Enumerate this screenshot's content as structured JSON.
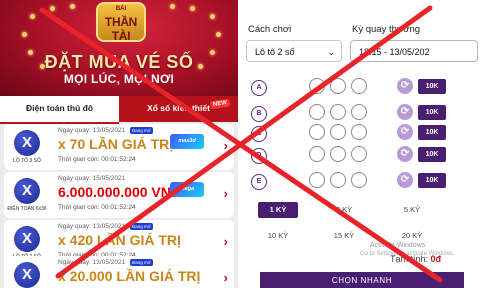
{
  "left": {
    "banner": {
      "logo_small": "BÁI",
      "logo_big": "THẦN TÀI",
      "title": "ĐẶT MUA VÉ SỐ",
      "subtitle": "MỌI LÚC, MỌI NƠI"
    },
    "tabs": [
      {
        "label": "Điện toán thủ đô"
      },
      {
        "label": "Xổ số kiến thiết"
      }
    ],
    "new_badge": "NEW",
    "cards": [
      {
        "icon_letter": "X",
        "icon_label": "LÔ TÔ 3 SỐ",
        "date": "Ngày quay: 13/05/2021",
        "live": "Đang mở",
        "prize": "x 70 LẦN GIÁ TRỊ",
        "timer": "Thời gian còn: 00:01:52:24",
        "logo": "max3d",
        "prize_color": "gold"
      },
      {
        "icon_letter": "X",
        "icon_label": "ĐIỆN TOÁN 6x36",
        "date": "Ngày quay: 15/05/2021",
        "live": "",
        "prize": "6.000.000.000 VNĐ",
        "timer": "Thời gian còn: 00:01:52:24",
        "logo": "mega",
        "prize_color": "red"
      },
      {
        "icon_letter": "X",
        "icon_label": "LÔ TÔ 2 SỐ",
        "date": "Ngày quay: 13/05/2021",
        "live": "Đang mở",
        "prize": "x 420 LẦN GIÁ TRỊ",
        "timer": "Thời gian còn: 00:01:52:24",
        "logo": "",
        "prize_color": "gold"
      },
      {
        "icon_letter": "X",
        "icon_label": "",
        "date": "Ngày quay: 13/05/2021",
        "live": "Đang mở",
        "prize": "x 20.000 LẦN GIÁ TRỊ",
        "timer": "",
        "logo": "",
        "prize_color": "gold"
      }
    ]
  },
  "right": {
    "play_label": "Cách chơi",
    "play_value": "Lô tô 2 số",
    "draw_label": "Kỳ quay thưởng",
    "draw_value": "18:15 - 13/05/202",
    "rows": [
      {
        "letter": "A",
        "price": "10K"
      },
      {
        "letter": "B",
        "price": "10K"
      },
      {
        "letter": "C",
        "price": "10K"
      },
      {
        "letter": "D",
        "price": "10K"
      },
      {
        "letter": "E",
        "price": "10K"
      }
    ],
    "periods": [
      "1 KỲ",
      "2 KỲ",
      "5 KỲ",
      "10 KỲ",
      "15 KỲ",
      "20 KỲ"
    ],
    "active_period": "1 KỲ",
    "watermark_line1": "Activate Windows",
    "watermark_line2": "Go to Settings to activate Windows.",
    "total_label": "Tạm tính:",
    "total_value": "0đ",
    "quick_button": "CHỌN NHANH"
  },
  "colors": {
    "brand_red": "#b5121b",
    "brand_purple": "#4a1e70",
    "prize_gold": "#c8861a",
    "prize_red": "#e00000",
    "cross_red": "#e8232a"
  },
  "icons": [
    "chevron-down-icon",
    "refresh-icon",
    "chevron-right-icon",
    "lottery-ball-icon"
  ]
}
